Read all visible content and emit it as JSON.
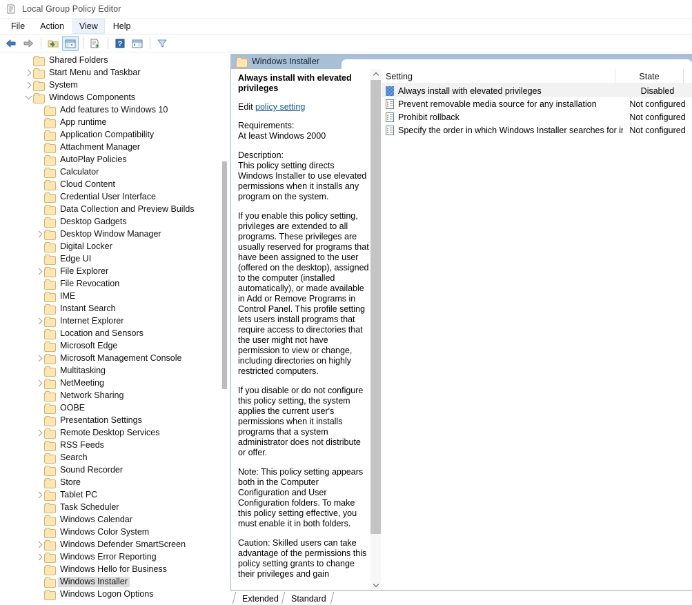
{
  "window": {
    "title": "Local Group Policy Editor",
    "icon": "policy-editor-icon"
  },
  "menubar": {
    "items": [
      {
        "label": "File",
        "active": false
      },
      {
        "label": "Action",
        "active": false
      },
      {
        "label": "View",
        "active": true
      },
      {
        "label": "Help",
        "active": false
      }
    ]
  },
  "toolbar": {
    "buttons": [
      {
        "name": "back-icon",
        "label": "Back"
      },
      {
        "name": "forward-icon",
        "label": "Forward"
      },
      {
        "name": "up-one-level-icon",
        "label": "Up One Level"
      },
      {
        "name": "show-hide-console-tree-icon",
        "label": "Show/Hide Console Tree"
      },
      {
        "name": "export-list-icon",
        "label": "Export List"
      },
      {
        "name": "help-icon",
        "label": "Help"
      },
      {
        "name": "show-hide-action-pane-icon",
        "label": "Show/Hide Action Pane"
      },
      {
        "name": "filter-icon",
        "label": "Filter"
      }
    ]
  },
  "tree": {
    "items": [
      {
        "label": "Shared Folders",
        "indent": 2,
        "twisty": "none",
        "selected": false
      },
      {
        "label": "Start Menu and Taskbar",
        "indent": 2,
        "twisty": "closed",
        "selected": false
      },
      {
        "label": "System",
        "indent": 2,
        "twisty": "closed",
        "selected": false
      },
      {
        "label": "Windows Components",
        "indent": 2,
        "twisty": "open",
        "selected": false
      },
      {
        "label": "Add features to Windows 10",
        "indent": 3,
        "twisty": "none",
        "selected": false
      },
      {
        "label": "App runtime",
        "indent": 3,
        "twisty": "none",
        "selected": false
      },
      {
        "label": "Application Compatibility",
        "indent": 3,
        "twisty": "none",
        "selected": false
      },
      {
        "label": "Attachment Manager",
        "indent": 3,
        "twisty": "none",
        "selected": false
      },
      {
        "label": "AutoPlay Policies",
        "indent": 3,
        "twisty": "none",
        "selected": false
      },
      {
        "label": "Calculator",
        "indent": 3,
        "twisty": "none",
        "selected": false
      },
      {
        "label": "Cloud Content",
        "indent": 3,
        "twisty": "none",
        "selected": false
      },
      {
        "label": "Credential User Interface",
        "indent": 3,
        "twisty": "none",
        "selected": false
      },
      {
        "label": "Data Collection and Preview Builds",
        "indent": 3,
        "twisty": "none",
        "selected": false
      },
      {
        "label": "Desktop Gadgets",
        "indent": 3,
        "twisty": "none",
        "selected": false
      },
      {
        "label": "Desktop Window Manager",
        "indent": 3,
        "twisty": "closed",
        "selected": false
      },
      {
        "label": "Digital Locker",
        "indent": 3,
        "twisty": "none",
        "selected": false
      },
      {
        "label": "Edge UI",
        "indent": 3,
        "twisty": "none",
        "selected": false
      },
      {
        "label": "File Explorer",
        "indent": 3,
        "twisty": "closed",
        "selected": false
      },
      {
        "label": "File Revocation",
        "indent": 3,
        "twisty": "none",
        "selected": false
      },
      {
        "label": "IME",
        "indent": 3,
        "twisty": "none",
        "selected": false
      },
      {
        "label": "Instant Search",
        "indent": 3,
        "twisty": "none",
        "selected": false
      },
      {
        "label": "Internet Explorer",
        "indent": 3,
        "twisty": "closed",
        "selected": false
      },
      {
        "label": "Location and Sensors",
        "indent": 3,
        "twisty": "none",
        "selected": false
      },
      {
        "label": "Microsoft Edge",
        "indent": 3,
        "twisty": "none",
        "selected": false
      },
      {
        "label": "Microsoft Management Console",
        "indent": 3,
        "twisty": "closed",
        "selected": false
      },
      {
        "label": "Multitasking",
        "indent": 3,
        "twisty": "none",
        "selected": false
      },
      {
        "label": "NetMeeting",
        "indent": 3,
        "twisty": "closed",
        "selected": false
      },
      {
        "label": "Network Sharing",
        "indent": 3,
        "twisty": "none",
        "selected": false
      },
      {
        "label": "OOBE",
        "indent": 3,
        "twisty": "none",
        "selected": false
      },
      {
        "label": "Presentation Settings",
        "indent": 3,
        "twisty": "none",
        "selected": false
      },
      {
        "label": "Remote Desktop Services",
        "indent": 3,
        "twisty": "closed",
        "selected": false
      },
      {
        "label": "RSS Feeds",
        "indent": 3,
        "twisty": "none",
        "selected": false
      },
      {
        "label": "Search",
        "indent": 3,
        "twisty": "none",
        "selected": false
      },
      {
        "label": "Sound Recorder",
        "indent": 3,
        "twisty": "none",
        "selected": false
      },
      {
        "label": "Store",
        "indent": 3,
        "twisty": "none",
        "selected": false
      },
      {
        "label": "Tablet PC",
        "indent": 3,
        "twisty": "closed",
        "selected": false
      },
      {
        "label": "Task Scheduler",
        "indent": 3,
        "twisty": "none",
        "selected": false
      },
      {
        "label": "Windows Calendar",
        "indent": 3,
        "twisty": "none",
        "selected": false
      },
      {
        "label": "Windows Color System",
        "indent": 3,
        "twisty": "none",
        "selected": false
      },
      {
        "label": "Windows Defender SmartScreen",
        "indent": 3,
        "twisty": "closed",
        "selected": false
      },
      {
        "label": "Windows Error Reporting",
        "indent": 3,
        "twisty": "closed",
        "selected": false
      },
      {
        "label": "Windows Hello for Business",
        "indent": 3,
        "twisty": "none",
        "selected": false
      },
      {
        "label": "Windows Installer",
        "indent": 3,
        "twisty": "none",
        "selected": true
      },
      {
        "label": "Windows Logon Options",
        "indent": 3,
        "twisty": "none",
        "selected": false
      }
    ]
  },
  "pane_header": {
    "title": "Windows Installer",
    "icon": "folder-icon"
  },
  "detail": {
    "title": "Always install with elevated privileges",
    "edit_prefix": "Edit ",
    "edit_link": "policy setting",
    "requirements_label": "Requirements:",
    "requirements_value": "At least Windows 2000",
    "description_label": "Description:",
    "paragraphs": [
      "This policy setting directs Windows Installer to use elevated permissions when it installs any program on the system.",
      "If you enable this policy setting, privileges are extended to all programs. These privileges are usually reserved for programs that have been assigned to the user (offered on the desktop), assigned to the computer (installed automatically), or made available in Add or Remove Programs in Control Panel. This profile setting lets users install programs that require access to directories that the user might not have permission to view or change, including directories on highly restricted computers.",
      "If you disable or do not configure this policy setting, the system applies the current user's permissions when it installs programs that a system administrator does not distribute or offer.",
      "Note: This policy setting appears both in the Computer Configuration and User Configuration folders. To make this policy setting effective, you must enable it in both folders.",
      "Caution: Skilled users can take advantage of the permissions this policy setting grants to change their privileges and gain"
    ]
  },
  "list": {
    "columns": [
      {
        "label": "Setting",
        "name": "column-setting"
      },
      {
        "label": "State",
        "name": "column-state"
      }
    ],
    "rows": [
      {
        "setting": "Always install with elevated privileges",
        "state": "Disabled",
        "selected": true
      },
      {
        "setting": "Prevent removable media source for any installation",
        "state": "Not configured",
        "selected": false
      },
      {
        "setting": "Prohibit rollback",
        "state": "Not configured",
        "selected": false
      },
      {
        "setting": "Specify the order in which Windows Installer searches for ins...",
        "state": "Not configured",
        "selected": false
      }
    ]
  },
  "tabs": {
    "items": [
      {
        "label": "Extended",
        "active": false
      },
      {
        "label": "Standard",
        "active": true
      }
    ]
  },
  "colors": {
    "pane_header_bg": "#a8c0d6",
    "selection_bg": "#f2f2f2",
    "tree_selection_bg": "#dcdcdc",
    "link": "#0b58a8",
    "folder": "#fbe6b4"
  }
}
